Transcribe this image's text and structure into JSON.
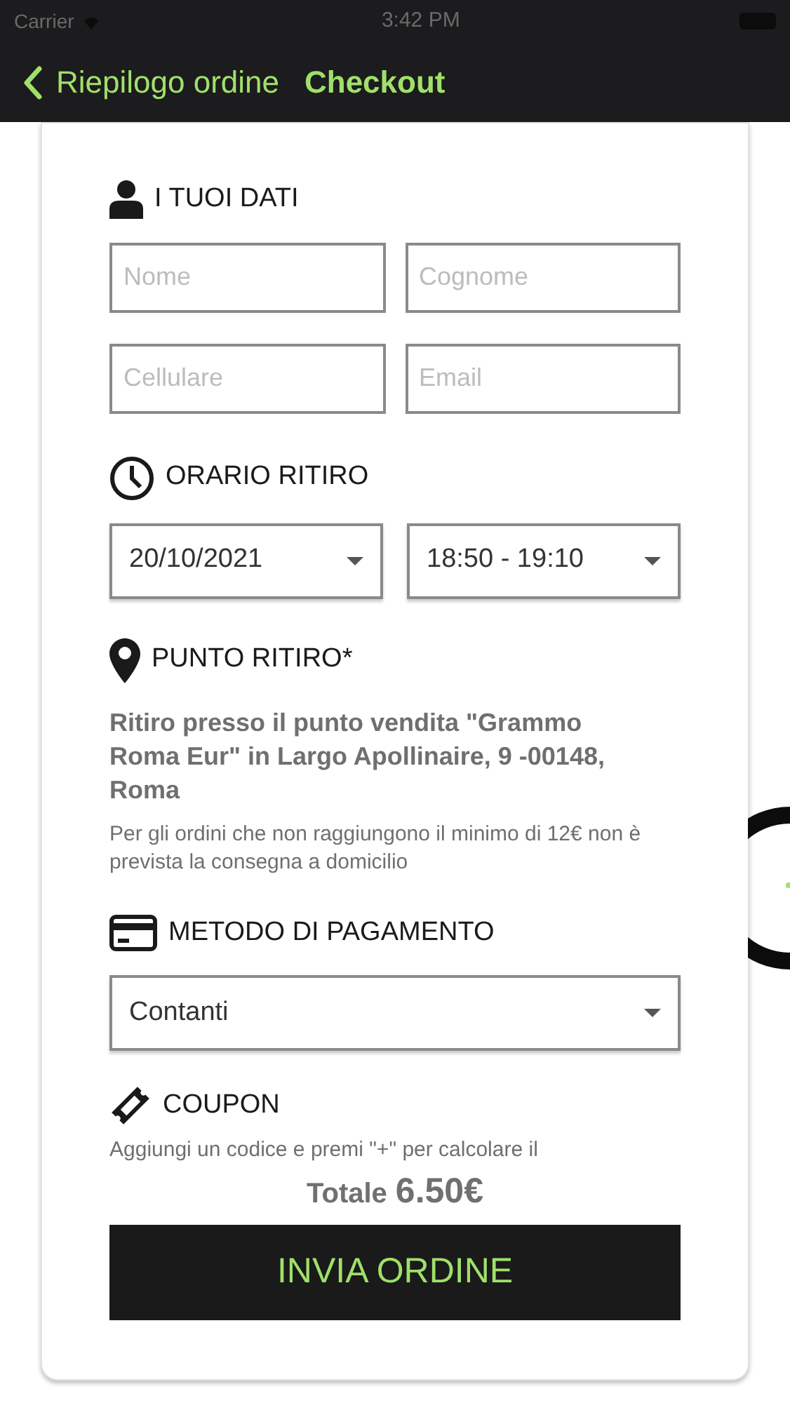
{
  "status_bar": {
    "carrier": "Carrier",
    "time": "3:42 PM"
  },
  "nav": {
    "back": "Riepilogo ordine",
    "title": "Checkout"
  },
  "sections": [
    {
      "kind": "fields",
      "title": "I TUOI DATI",
      "fields": [
        {
          "placeholder": "Nome"
        },
        {
          "placeholder": "Cognome"
        },
        {
          "placeholder": "Cellulare"
        },
        {
          "placeholder": "Email"
        }
      ]
    },
    {
      "kind": "selects",
      "title": "ORARIO RITIRO",
      "selects": [
        {
          "value": "20/10/2021"
        },
        {
          "value": "18:50 - 19:10"
        }
      ]
    },
    {
      "kind": "info",
      "title": "PUNTO RITIRO*",
      "address": "Ritiro presso il punto vendita \"Grammo Roma Eur\" in Largo Apollinaire, 9 -00148, Roma",
      "note": "Per gli ordini che non raggiungono il minimo di 12€ non è prevista la consegna a domicilio"
    },
    {
      "kind": "select",
      "title": "METODO DI PAGAMENTO",
      "value": "Contanti"
    },
    {
      "kind": "text",
      "title": "COUPON",
      "text": "Aggiungi un codice e premi \"+\" per calcolare il"
    }
  ],
  "total": {
    "label": "Totale",
    "amount": "6.50€"
  },
  "submit": "INVIA ORDINE"
}
